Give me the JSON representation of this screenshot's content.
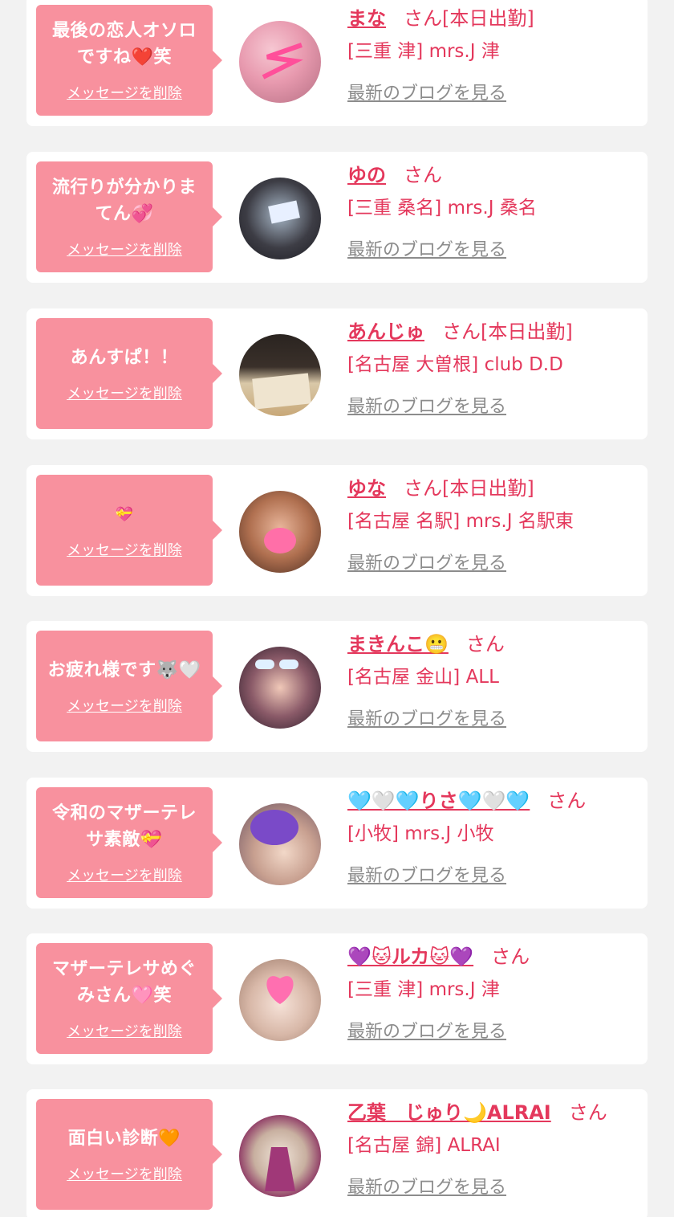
{
  "delete_label": "メッセージを削除",
  "blog_label": "最新のブログを見る",
  "colors": {
    "background": "#f2f2f2",
    "card": "#ffffff",
    "bubble": "#f8919e",
    "accent": "#e4385c",
    "link_gray": "#8c8c8c"
  },
  "messages": [
    {
      "message": "最後の恋人オソロですね❤️笑",
      "name": "まな",
      "suffix": "さん[本日出勤]",
      "shop": "[三重 津] mrs.J 津",
      "avatar_icon": "avatar-photo"
    },
    {
      "message": "流行りが分かりまてん💞",
      "name": "ゆの",
      "suffix": "さん",
      "shop": "[三重 桑名] mrs.J 桑名",
      "avatar_icon": "avatar-photo"
    },
    {
      "message": "あんすぱ！！",
      "name": "あんじゅ",
      "suffix": "さん[本日出勤]",
      "shop": "[名古屋 大曽根] club D.D",
      "avatar_icon": "avatar-photo"
    },
    {
      "message": "💝",
      "name": "ゆな",
      "suffix": "さん[本日出勤]",
      "shop": "[名古屋 名駅] mrs.J 名駅東",
      "avatar_icon": "avatar-photo"
    },
    {
      "message": "お疲れ様です🐺🤍",
      "name": "まきんこ😬",
      "suffix": "さん",
      "shop": "[名古屋 金山] ALL",
      "avatar_icon": "avatar-photo"
    },
    {
      "message": "令和のマザーテレサ素敵💝",
      "name": "🩵🤍🩵りさ🩵🤍🩵",
      "suffix": "さん",
      "shop": "[小牧] mrs.J 小牧",
      "avatar_icon": "avatar-photo"
    },
    {
      "message": "マザーテレサめぐみさん🩷笑",
      "name": "💜🐱ルカ🐱💜",
      "suffix": "さん",
      "shop": "[三重 津] mrs.J 津",
      "avatar_icon": "avatar-photo"
    },
    {
      "message": "面白い診断🧡",
      "name": "乙葉　じゅり🌙ALRAI",
      "suffix": "さん",
      "shop": "[名古屋 錦] ALRAI",
      "avatar_icon": "avatar-photo"
    }
  ]
}
